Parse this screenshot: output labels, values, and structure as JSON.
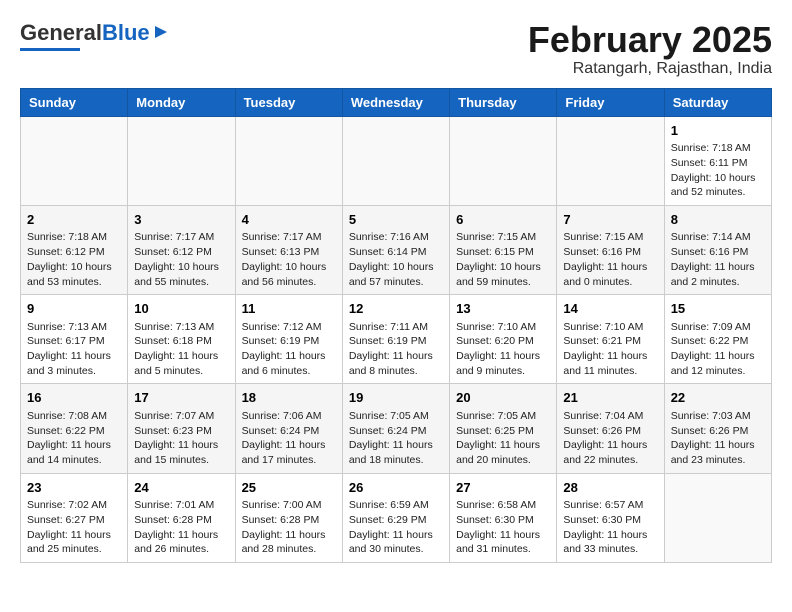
{
  "header": {
    "logo_general": "General",
    "logo_blue": "Blue",
    "month_title": "February 2025",
    "location": "Ratangarh, Rajasthan, India"
  },
  "days_of_week": [
    "Sunday",
    "Monday",
    "Tuesday",
    "Wednesday",
    "Thursday",
    "Friday",
    "Saturday"
  ],
  "weeks": [
    [
      {
        "day": "",
        "info": ""
      },
      {
        "day": "",
        "info": ""
      },
      {
        "day": "",
        "info": ""
      },
      {
        "day": "",
        "info": ""
      },
      {
        "day": "",
        "info": ""
      },
      {
        "day": "",
        "info": ""
      },
      {
        "day": "1",
        "info": "Sunrise: 7:18 AM\nSunset: 6:11 PM\nDaylight: 10 hours\nand 52 minutes."
      }
    ],
    [
      {
        "day": "2",
        "info": "Sunrise: 7:18 AM\nSunset: 6:12 PM\nDaylight: 10 hours\nand 53 minutes."
      },
      {
        "day": "3",
        "info": "Sunrise: 7:17 AM\nSunset: 6:12 PM\nDaylight: 10 hours\nand 55 minutes."
      },
      {
        "day": "4",
        "info": "Sunrise: 7:17 AM\nSunset: 6:13 PM\nDaylight: 10 hours\nand 56 minutes."
      },
      {
        "day": "5",
        "info": "Sunrise: 7:16 AM\nSunset: 6:14 PM\nDaylight: 10 hours\nand 57 minutes."
      },
      {
        "day": "6",
        "info": "Sunrise: 7:15 AM\nSunset: 6:15 PM\nDaylight: 10 hours\nand 59 minutes."
      },
      {
        "day": "7",
        "info": "Sunrise: 7:15 AM\nSunset: 6:16 PM\nDaylight: 11 hours\nand 0 minutes."
      },
      {
        "day": "8",
        "info": "Sunrise: 7:14 AM\nSunset: 6:16 PM\nDaylight: 11 hours\nand 2 minutes."
      }
    ],
    [
      {
        "day": "9",
        "info": "Sunrise: 7:13 AM\nSunset: 6:17 PM\nDaylight: 11 hours\nand 3 minutes."
      },
      {
        "day": "10",
        "info": "Sunrise: 7:13 AM\nSunset: 6:18 PM\nDaylight: 11 hours\nand 5 minutes."
      },
      {
        "day": "11",
        "info": "Sunrise: 7:12 AM\nSunset: 6:19 PM\nDaylight: 11 hours\nand 6 minutes."
      },
      {
        "day": "12",
        "info": "Sunrise: 7:11 AM\nSunset: 6:19 PM\nDaylight: 11 hours\nand 8 minutes."
      },
      {
        "day": "13",
        "info": "Sunrise: 7:10 AM\nSunset: 6:20 PM\nDaylight: 11 hours\nand 9 minutes."
      },
      {
        "day": "14",
        "info": "Sunrise: 7:10 AM\nSunset: 6:21 PM\nDaylight: 11 hours\nand 11 minutes."
      },
      {
        "day": "15",
        "info": "Sunrise: 7:09 AM\nSunset: 6:22 PM\nDaylight: 11 hours\nand 12 minutes."
      }
    ],
    [
      {
        "day": "16",
        "info": "Sunrise: 7:08 AM\nSunset: 6:22 PM\nDaylight: 11 hours\nand 14 minutes."
      },
      {
        "day": "17",
        "info": "Sunrise: 7:07 AM\nSunset: 6:23 PM\nDaylight: 11 hours\nand 15 minutes."
      },
      {
        "day": "18",
        "info": "Sunrise: 7:06 AM\nSunset: 6:24 PM\nDaylight: 11 hours\nand 17 minutes."
      },
      {
        "day": "19",
        "info": "Sunrise: 7:05 AM\nSunset: 6:24 PM\nDaylight: 11 hours\nand 18 minutes."
      },
      {
        "day": "20",
        "info": "Sunrise: 7:05 AM\nSunset: 6:25 PM\nDaylight: 11 hours\nand 20 minutes."
      },
      {
        "day": "21",
        "info": "Sunrise: 7:04 AM\nSunset: 6:26 PM\nDaylight: 11 hours\nand 22 minutes."
      },
      {
        "day": "22",
        "info": "Sunrise: 7:03 AM\nSunset: 6:26 PM\nDaylight: 11 hours\nand 23 minutes."
      }
    ],
    [
      {
        "day": "23",
        "info": "Sunrise: 7:02 AM\nSunset: 6:27 PM\nDaylight: 11 hours\nand 25 minutes."
      },
      {
        "day": "24",
        "info": "Sunrise: 7:01 AM\nSunset: 6:28 PM\nDaylight: 11 hours\nand 26 minutes."
      },
      {
        "day": "25",
        "info": "Sunrise: 7:00 AM\nSunset: 6:28 PM\nDaylight: 11 hours\nand 28 minutes."
      },
      {
        "day": "26",
        "info": "Sunrise: 6:59 AM\nSunset: 6:29 PM\nDaylight: 11 hours\nand 30 minutes."
      },
      {
        "day": "27",
        "info": "Sunrise: 6:58 AM\nSunset: 6:30 PM\nDaylight: 11 hours\nand 31 minutes."
      },
      {
        "day": "28",
        "info": "Sunrise: 6:57 AM\nSunset: 6:30 PM\nDaylight: 11 hours\nand 33 minutes."
      },
      {
        "day": "",
        "info": ""
      }
    ]
  ]
}
